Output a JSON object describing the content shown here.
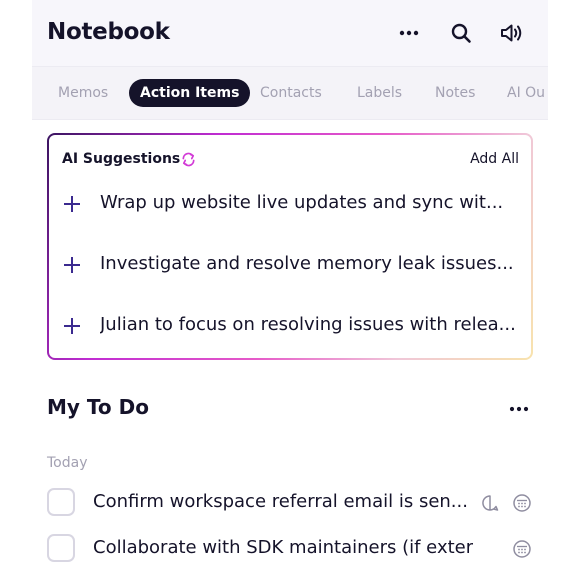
{
  "header": {
    "title": "Notebook",
    "icons": [
      "more-icon",
      "search-icon",
      "speaker-icon"
    ]
  },
  "tabs": [
    {
      "label": "Memos",
      "active": false
    },
    {
      "label": "Action Items",
      "active": true
    },
    {
      "label": "Contacts",
      "active": false
    },
    {
      "label": "Labels",
      "active": false
    },
    {
      "label": "Notes",
      "active": false
    },
    {
      "label": "AI Ou",
      "active": false
    }
  ],
  "ai_suggestions": {
    "title": "AI Suggestions",
    "add_all_label": "Add All",
    "items": [
      {
        "text": "Wrap up website live updates and sync wit..."
      },
      {
        "text": "Investigate and resolve memory leak issues..."
      },
      {
        "text": "Julian to focus on resolving issues with relea..."
      }
    ]
  },
  "todo": {
    "title": "My To Do",
    "group_label": "Today",
    "items": [
      {
        "text": "Confirm workspace referral email is sen...",
        "icons": [
          "comment-icon",
          "calendar-icon"
        ]
      },
      {
        "text": "Collaborate with SDK maintainers (if exter...",
        "icons": [
          "calendar-icon"
        ]
      }
    ]
  },
  "colors": {
    "primary_text": "#15132a",
    "muted_text": "#a3a1b2",
    "active_tab_bg": "#15132a",
    "accent": "#d23ad6",
    "ai_gradient": [
      "#3a1460",
      "#c02cd2",
      "#e65ac9",
      "#f0c7d8",
      "#f8e3ad"
    ]
  }
}
